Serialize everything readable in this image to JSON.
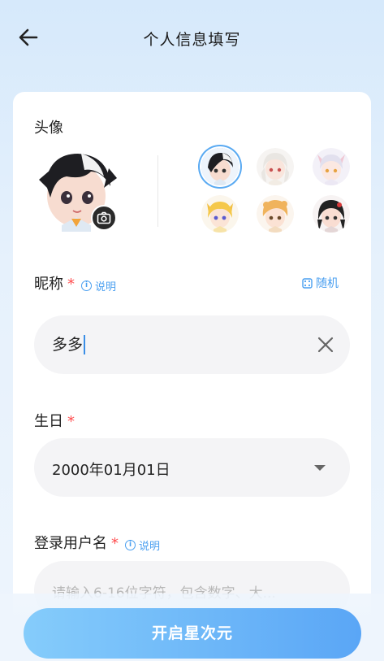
{
  "header": {
    "title": "个人信息填写",
    "back_icon": "arrow-left-icon"
  },
  "avatar": {
    "label": "头像",
    "options": [
      "avatar-1",
      "avatar-2",
      "avatar-3",
      "avatar-4",
      "avatar-5",
      "avatar-6"
    ],
    "selected_index": 0
  },
  "nickname": {
    "label": "昵称",
    "required": "*",
    "info": "说明",
    "random": "随机",
    "value": "多多"
  },
  "birthday": {
    "label": "生日",
    "required": "*",
    "value": "2000年01月01日"
  },
  "username": {
    "label": "登录用户名",
    "required": "*",
    "info": "说明",
    "placeholder": "请输入6-16位字符，包含数字、大..."
  },
  "cta": {
    "label": "开启星次元"
  },
  "colors": {
    "accent": "#4a9ff0",
    "required": "#ff4d4f",
    "cta_start": "#85ccfb",
    "cta_end": "#5aa6f6"
  }
}
